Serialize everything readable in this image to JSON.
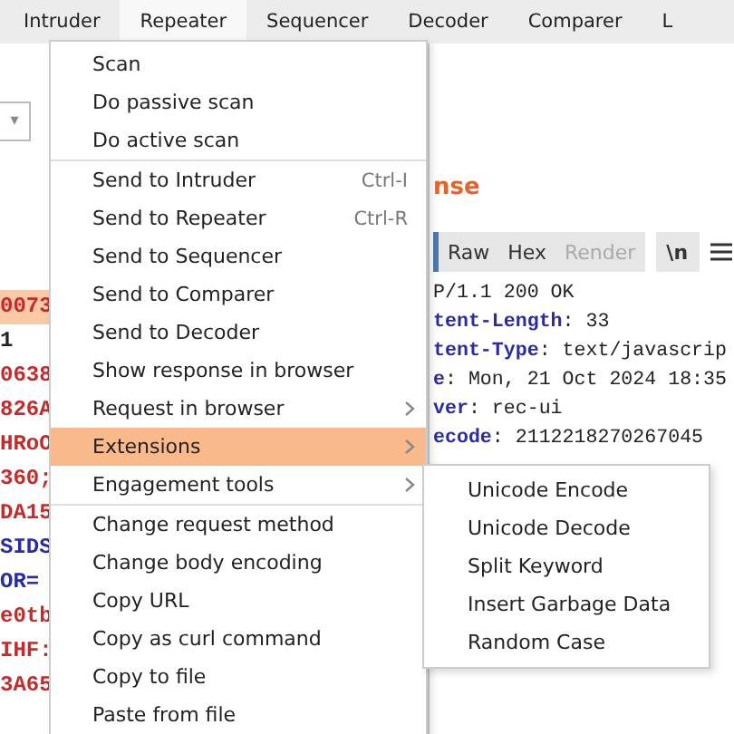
{
  "tabs": [
    {
      "label": "Intruder",
      "selected": false
    },
    {
      "label": "Repeater",
      "selected": true
    },
    {
      "label": "Sequencer",
      "selected": false
    },
    {
      "label": "Decoder",
      "selected": false
    },
    {
      "label": "Comparer",
      "selected": false
    },
    {
      "label": "L",
      "selected": false
    }
  ],
  "request_pane": {
    "dropdown_caret": "▾",
    "lines": [
      {
        "text": "0073",
        "kind": "value",
        "highlighted": true
      },
      {
        "text": "1",
        "kind": "plain",
        "highlighted": false
      },
      {
        "text": "0638",
        "kind": "value",
        "highlighted": false
      },
      {
        "text": "826A",
        "kind": "value",
        "highlighted": false
      },
      {
        "text": "HRoO",
        "kind": "value",
        "highlighted": false
      },
      {
        "text": "360;",
        "kind": "value",
        "highlighted": false
      },
      {
        "text": "DA15",
        "kind": "value",
        "highlighted": false
      },
      {
        "text": "SIDS",
        "kind": "name",
        "highlighted": false
      },
      {
        "text": "OR=",
        "kind": "name",
        "highlighted": false
      },
      {
        "text": "e0tb",
        "kind": "value",
        "highlighted": false
      },
      {
        "text": "IHF:",
        "kind": "value",
        "highlighted": false
      },
      {
        "text": "3A65",
        "kind": "value",
        "highlighted": false
      }
    ]
  },
  "response_pane": {
    "title": "nse",
    "view_tabs": [
      {
        "label": "Raw",
        "disabled": false
      },
      {
        "label": "Hex",
        "disabled": false
      },
      {
        "label": "Render",
        "disabled": true
      }
    ],
    "newline_button": "\\n",
    "lines": [
      {
        "kind": "status",
        "name": "P/1.1 200 OK"
      },
      {
        "kind": "header",
        "name": "tent-Length",
        "value": ": 33"
      },
      {
        "kind": "header",
        "name": "tent-Type",
        "value": ": text/javascrip"
      },
      {
        "kind": "header",
        "name": "e",
        "value": ": Mon, 21 Oct 2024 18:35"
      },
      {
        "kind": "header",
        "name": "ver",
        "value": ": rec-ui"
      },
      {
        "kind": "header",
        "name": "ecode",
        "value": ": 2112218270267045"
      }
    ]
  },
  "context_menu": {
    "groups": [
      [
        {
          "label": "Scan",
          "has_submenu": false,
          "highlighted": false
        },
        {
          "label": "Do passive scan",
          "has_submenu": false,
          "highlighted": false
        },
        {
          "label": "Do active scan",
          "has_submenu": false,
          "highlighted": false
        }
      ],
      [
        {
          "label": "Send to Intruder",
          "shortcut": "Ctrl-I",
          "has_submenu": false,
          "highlighted": false
        },
        {
          "label": "Send to Repeater",
          "shortcut": "Ctrl-R",
          "has_submenu": false,
          "highlighted": false
        },
        {
          "label": "Send to Sequencer",
          "has_submenu": false,
          "highlighted": false
        },
        {
          "label": "Send to Comparer",
          "has_submenu": false,
          "highlighted": false
        },
        {
          "label": "Send to Decoder",
          "has_submenu": false,
          "highlighted": false
        },
        {
          "label": "Show response in browser",
          "has_submenu": false,
          "highlighted": false
        },
        {
          "label": "Request in browser",
          "has_submenu": true,
          "highlighted": false
        },
        {
          "label": "Extensions",
          "has_submenu": true,
          "highlighted": true
        },
        {
          "label": "Engagement tools",
          "has_submenu": true,
          "highlighted": false
        }
      ],
      [
        {
          "label": "Change request method",
          "has_submenu": false,
          "highlighted": false
        },
        {
          "label": "Change body encoding",
          "has_submenu": false,
          "highlighted": false
        },
        {
          "label": "Copy URL",
          "has_submenu": false,
          "highlighted": false
        },
        {
          "label": "Copy as curl command",
          "has_submenu": false,
          "highlighted": false
        },
        {
          "label": "Copy to file",
          "has_submenu": false,
          "highlighted": false
        },
        {
          "label": "Paste from file",
          "has_submenu": false,
          "highlighted": false
        }
      ]
    ]
  },
  "submenu": {
    "items": [
      "Unicode Encode",
      "Unicode Decode",
      "Split Keyword",
      "Insert Garbage Data",
      "Random Case"
    ]
  }
}
